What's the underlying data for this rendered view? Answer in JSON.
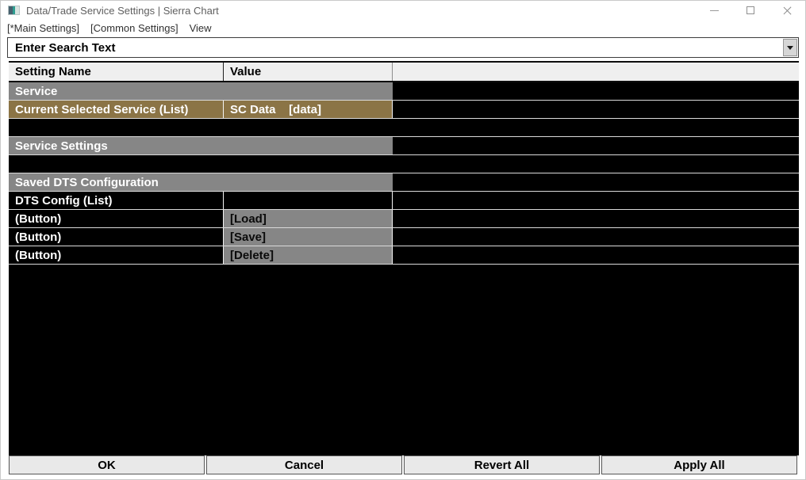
{
  "window": {
    "title": "Data/Trade Service Settings | Sierra Chart"
  },
  "menu": {
    "items": [
      {
        "label": "[*Main Settings]"
      },
      {
        "label": "[Common Settings]"
      },
      {
        "label": "View"
      }
    ]
  },
  "search": {
    "value": "Enter Search Text"
  },
  "grid": {
    "columns": [
      "Setting Name",
      "Value"
    ],
    "rows": [
      {
        "type": "section",
        "name": "Service",
        "value": ""
      },
      {
        "type": "selected",
        "name": "Current Selected Service (List)",
        "value": "SC Data    [data]"
      },
      {
        "type": "blank",
        "name": "",
        "value": ""
      },
      {
        "type": "section",
        "name": "Service Settings",
        "value": ""
      },
      {
        "type": "blank",
        "name": "",
        "value": ""
      },
      {
        "type": "section",
        "name": "Saved DTS Configuration",
        "value": ""
      },
      {
        "type": "item",
        "name": "DTS Config (List)",
        "value": ""
      },
      {
        "type": "button",
        "name": "(Button)",
        "value": "[Load]"
      },
      {
        "type": "button",
        "name": "(Button)",
        "value": "[Save]"
      },
      {
        "type": "button",
        "name": "(Button)",
        "value": "[Delete]"
      }
    ]
  },
  "footer": {
    "buttons": [
      {
        "label": "OK"
      },
      {
        "label": "Cancel"
      },
      {
        "label": "Revert All"
      },
      {
        "label": "Apply All"
      }
    ]
  },
  "colors": {
    "selected_row": "#8b7446",
    "section_row": "#868686",
    "row_background": "#000000",
    "header_bg": "#efefef",
    "footer_button_bg": "#e9e9e9"
  }
}
